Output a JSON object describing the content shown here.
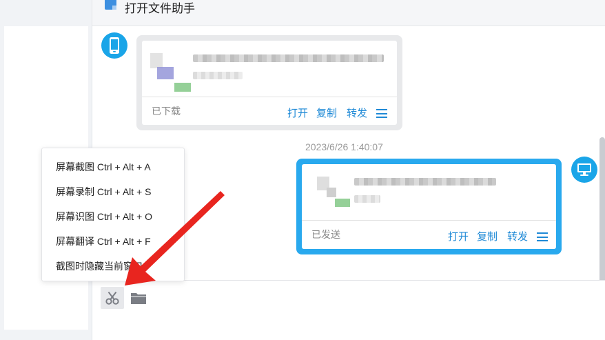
{
  "window": {
    "title": "打开文件助手"
  },
  "messages": [
    {
      "direction": "incoming",
      "avatar_icon": "phone-icon",
      "status": "已下载",
      "actions": {
        "open": "打开",
        "copy": "复制",
        "forward": "转发"
      },
      "more_icon": "menu-icon"
    },
    {
      "direction": "outgoing",
      "timestamp": "2023/6/26 1:40:07",
      "avatar_icon": "monitor-icon",
      "status": "已发送",
      "actions": {
        "open": "打开",
        "copy": "复制",
        "forward": "转发"
      },
      "more_icon": "menu-icon"
    }
  ],
  "popup_menu": {
    "items": [
      "屏幕截图 Ctrl + Alt + A",
      "屏幕录制 Ctrl + Alt + S",
      "屏幕识图 Ctrl + Alt + O",
      "屏幕翻译 Ctrl + Alt + F",
      "截图时隐藏当前窗口"
    ]
  },
  "toolbar": {
    "tools": [
      {
        "name": "screenshot",
        "icon": "scissors-icon"
      },
      {
        "name": "file",
        "icon": "folder-icon"
      }
    ]
  },
  "colors": {
    "accent": "#1aa5e8",
    "link": "#1e89d6",
    "arrow": "#e8251f",
    "outgoing_border": "#29a9ee",
    "incoming_border": "#e8e9eb"
  }
}
